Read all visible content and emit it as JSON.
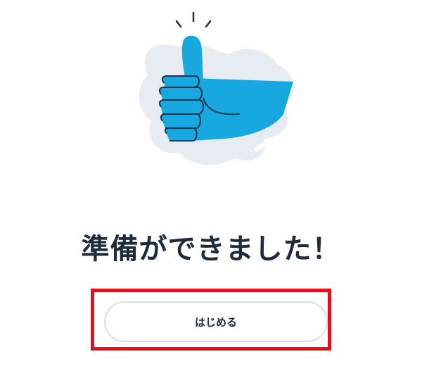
{
  "illustration": {
    "icon": "thumbs-up-icon",
    "colors": {
      "hand": "#16a8df",
      "outline": "#16344a",
      "blob": "#e6ecf2"
    }
  },
  "main": {
    "headline": "準備ができました！",
    "start_button_label": "はじめる"
  },
  "colors": {
    "text": "#1d2b3a",
    "highlight": "#e30f1b",
    "button_border": "#d7dde5"
  }
}
